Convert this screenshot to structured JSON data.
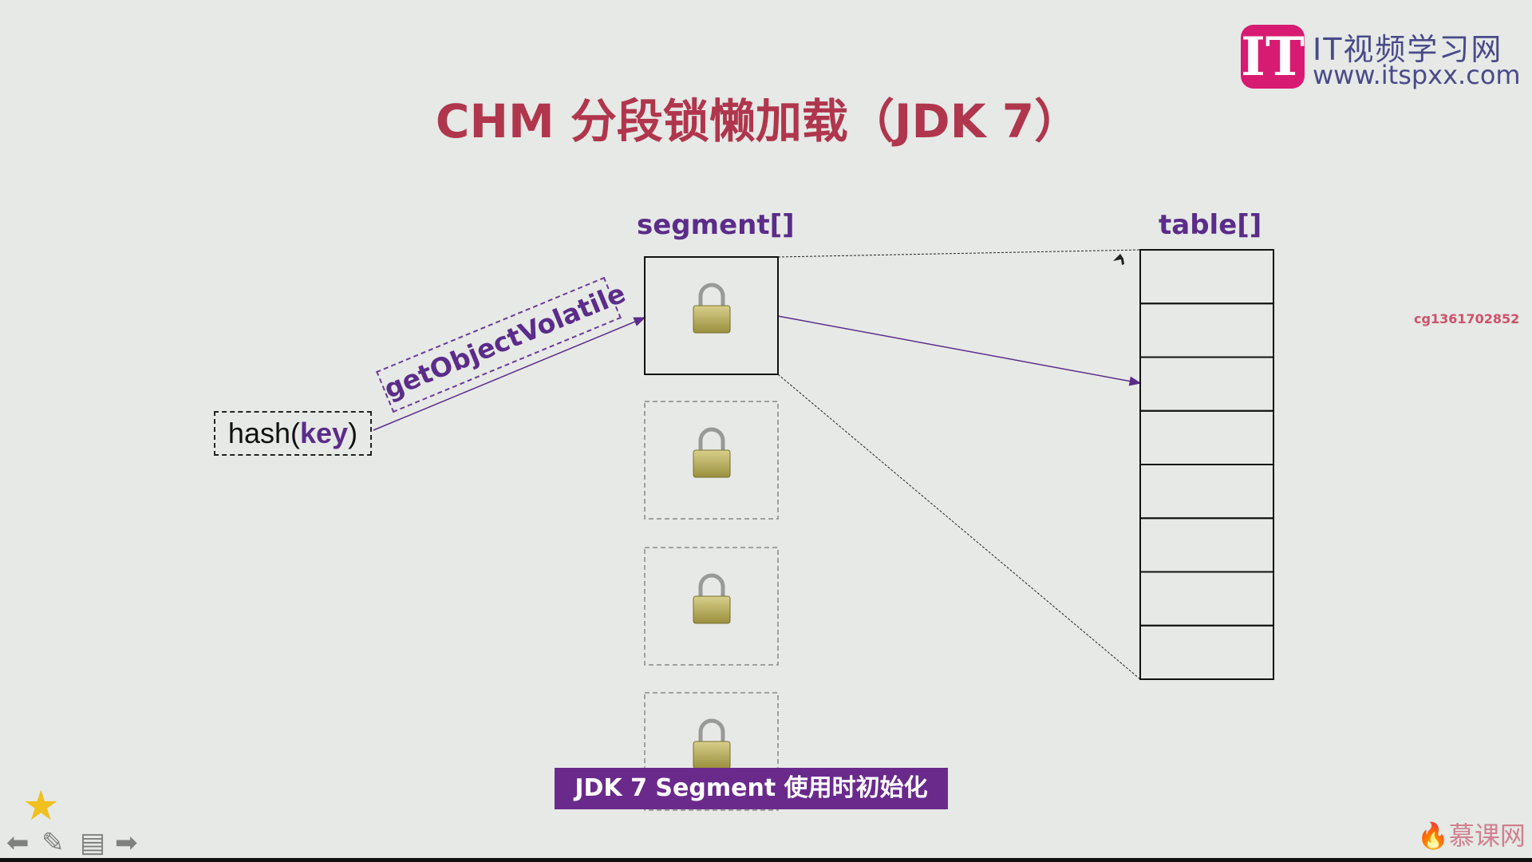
{
  "slide": {
    "title": "CHM 分段锁懒加载（JDK 7）",
    "segment_label": "segment[]",
    "table_label": "table[]",
    "hash_prefix": "hash(",
    "hash_key": "key",
    "hash_suffix": ")",
    "method_label": "getObjectVolatile",
    "caption": "JDK 7 Segment 使用时初始化",
    "segment_count_visible": 4,
    "table_rows": 8
  },
  "watermark": {
    "user_id": "cg1361702852",
    "site": "慕课网"
  },
  "logo": {
    "mark": "IT",
    "name": "IT视频学习网",
    "url": "www.itspxx.com"
  },
  "controls": {
    "prev": "prev-icon",
    "pen": "pen-icon",
    "notes": "notes-icon",
    "next": "next-icon",
    "star": "star-icon"
  },
  "colors": {
    "title": "#b0364d",
    "accent": "#5b2c8a",
    "caption_bg": "#6a2a8c",
    "logo": "#d81b72"
  }
}
